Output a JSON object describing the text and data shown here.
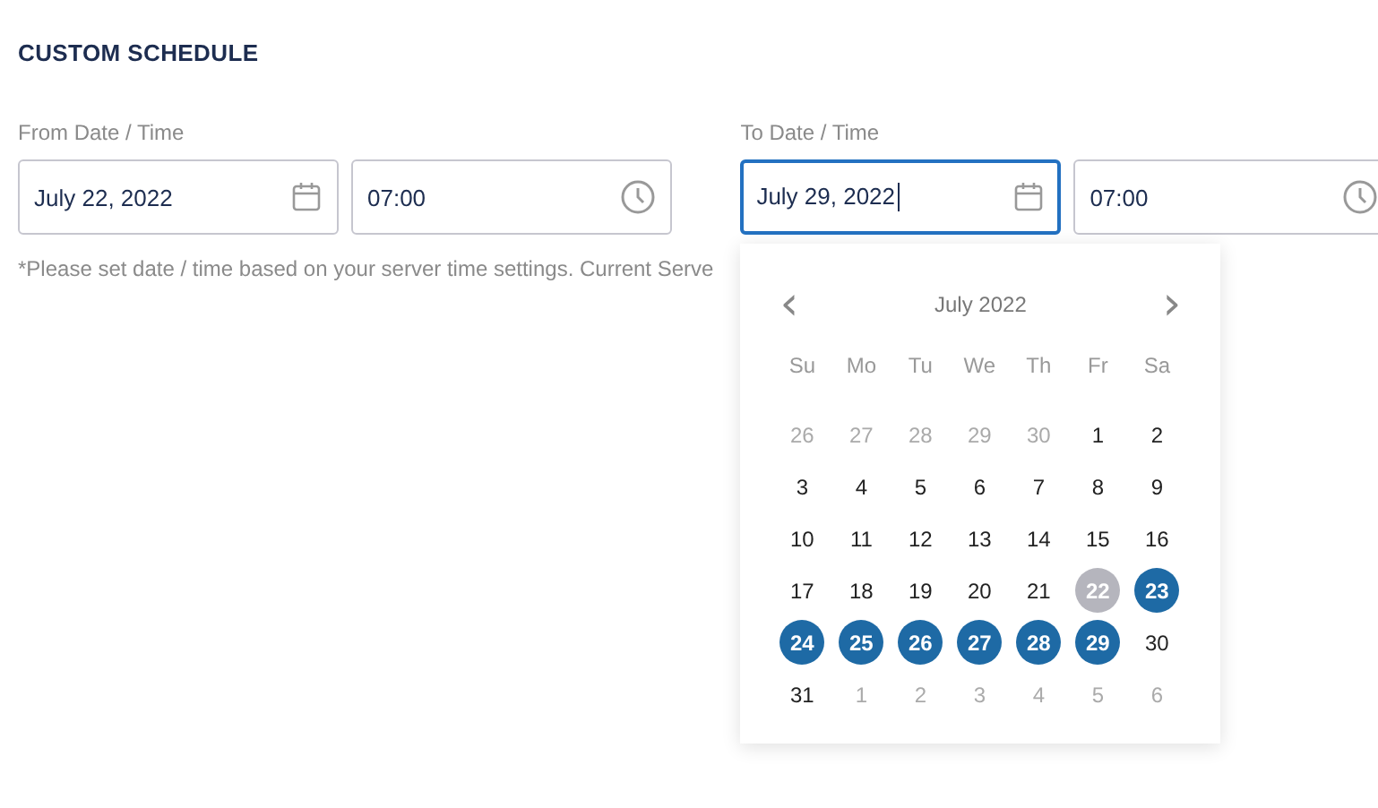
{
  "heading": "CUSTOM SCHEDULE",
  "from": {
    "label": "From Date / Time",
    "date": "July 22, 2022",
    "time": "07:00",
    "focused": false
  },
  "to": {
    "label": "To Date / Time",
    "date": "July 29, 2022",
    "time": "07:00",
    "focused": true
  },
  "note": "*Please set date / time based on your server time settings. Current Serve",
  "calendar": {
    "prev": "‹",
    "next": "›",
    "month": "July 2022",
    "weekdays": [
      "Su",
      "Mo",
      "Tu",
      "We",
      "Th",
      "Fr",
      "Sa"
    ],
    "days": [
      {
        "text": "26",
        "outside_month": true,
        "selected": false,
        "range_start": false
      },
      {
        "text": "27",
        "outside_month": true,
        "selected": false,
        "range_start": false
      },
      {
        "text": "28",
        "outside_month": true,
        "selected": false,
        "range_start": false
      },
      {
        "text": "29",
        "outside_month": true,
        "selected": false,
        "range_start": false
      },
      {
        "text": "30",
        "outside_month": true,
        "selected": false,
        "range_start": false
      },
      {
        "text": "1",
        "outside_month": false,
        "selected": false,
        "range_start": false
      },
      {
        "text": "2",
        "outside_month": false,
        "selected": false,
        "range_start": false
      },
      {
        "text": "3",
        "outside_month": false,
        "selected": false,
        "range_start": false
      },
      {
        "text": "4",
        "outside_month": false,
        "selected": false,
        "range_start": false
      },
      {
        "text": "5",
        "outside_month": false,
        "selected": false,
        "range_start": false
      },
      {
        "text": "6",
        "outside_month": false,
        "selected": false,
        "range_start": false
      },
      {
        "text": "7",
        "outside_month": false,
        "selected": false,
        "range_start": false
      },
      {
        "text": "8",
        "outside_month": false,
        "selected": false,
        "range_start": false
      },
      {
        "text": "9",
        "outside_month": false,
        "selected": false,
        "range_start": false
      },
      {
        "text": "10",
        "outside_month": false,
        "selected": false,
        "range_start": false
      },
      {
        "text": "11",
        "outside_month": false,
        "selected": false,
        "range_start": false
      },
      {
        "text": "12",
        "outside_month": false,
        "selected": false,
        "range_start": false
      },
      {
        "text": "13",
        "outside_month": false,
        "selected": false,
        "range_start": false
      },
      {
        "text": "14",
        "outside_month": false,
        "selected": false,
        "range_start": false
      },
      {
        "text": "15",
        "outside_month": false,
        "selected": false,
        "range_start": false
      },
      {
        "text": "16",
        "outside_month": false,
        "selected": false,
        "range_start": false
      },
      {
        "text": "17",
        "outside_month": false,
        "selected": false,
        "range_start": false
      },
      {
        "text": "18",
        "outside_month": false,
        "selected": false,
        "range_start": false
      },
      {
        "text": "19",
        "outside_month": false,
        "selected": false,
        "range_start": false
      },
      {
        "text": "20",
        "outside_month": false,
        "selected": false,
        "range_start": false
      },
      {
        "text": "21",
        "outside_month": false,
        "selected": false,
        "range_start": false
      },
      {
        "text": "22",
        "outside_month": false,
        "selected": true,
        "range_start": true
      },
      {
        "text": "23",
        "outside_month": false,
        "selected": true,
        "range_start": false
      },
      {
        "text": "24",
        "outside_month": false,
        "selected": true,
        "range_start": false
      },
      {
        "text": "25",
        "outside_month": false,
        "selected": true,
        "range_start": false
      },
      {
        "text": "26",
        "outside_month": false,
        "selected": true,
        "range_start": false
      },
      {
        "text": "27",
        "outside_month": false,
        "selected": true,
        "range_start": false
      },
      {
        "text": "28",
        "outside_month": false,
        "selected": true,
        "range_start": false
      },
      {
        "text": "29",
        "outside_month": false,
        "selected": true,
        "range_start": false
      },
      {
        "text": "30",
        "outside_month": false,
        "selected": false,
        "range_start": false
      },
      {
        "text": "31",
        "outside_month": false,
        "selected": false,
        "range_start": false
      },
      {
        "text": "1",
        "outside_month": true,
        "selected": false,
        "range_start": false
      },
      {
        "text": "2",
        "outside_month": true,
        "selected": false,
        "range_start": false
      },
      {
        "text": "3",
        "outside_month": true,
        "selected": false,
        "range_start": false
      },
      {
        "text": "4",
        "outside_month": true,
        "selected": false,
        "range_start": false
      },
      {
        "text": "5",
        "outside_month": true,
        "selected": false,
        "range_start": false
      },
      {
        "text": "6",
        "outside_month": true,
        "selected": false,
        "range_start": false
      }
    ]
  }
}
